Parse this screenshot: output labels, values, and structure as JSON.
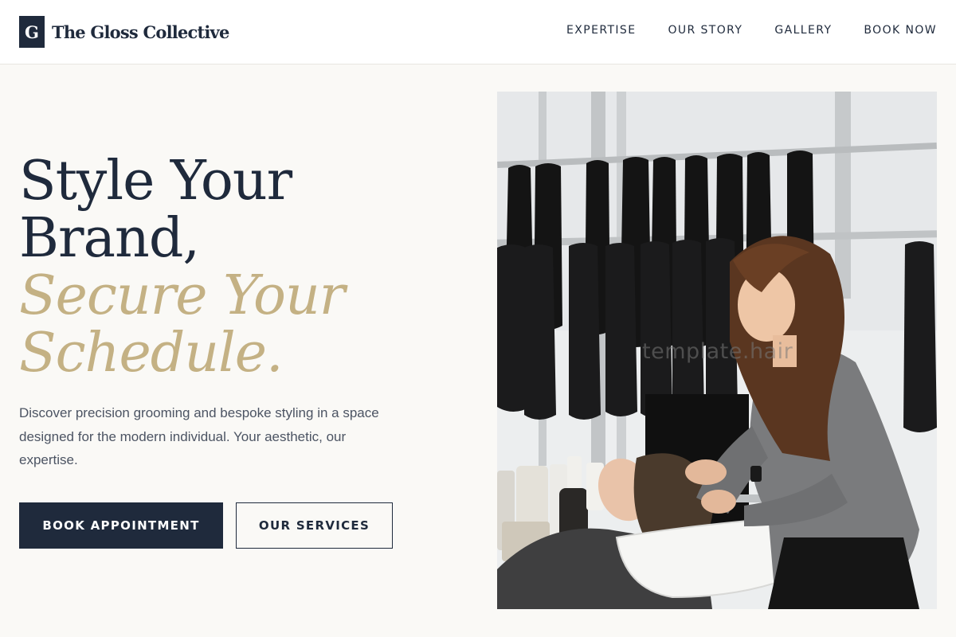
{
  "header": {
    "logo_mark": "G",
    "brand_name": "The Gloss Collective",
    "nav": [
      {
        "label": "EXPERTISE"
      },
      {
        "label": "OUR STORY"
      },
      {
        "label": "GALLERY"
      },
      {
        "label": "BOOK NOW"
      }
    ]
  },
  "hero": {
    "headline_line1": "Style Your",
    "headline_line2": "Brand,",
    "headline_accent1": "Secure Your",
    "headline_accent2": "Schedule.",
    "lead": "Discover precision grooming and bespoke styling in a space designed for the modern individual. Your aesthetic, our expertise.",
    "primary_cta": "BOOK APPOINTMENT",
    "secondary_cta": "OUR SERVICES",
    "image_watermark": "template.hair"
  },
  "colors": {
    "navy": "#1f2a3c",
    "gold_accent": "#c4b184",
    "background": "#faf9f6"
  }
}
